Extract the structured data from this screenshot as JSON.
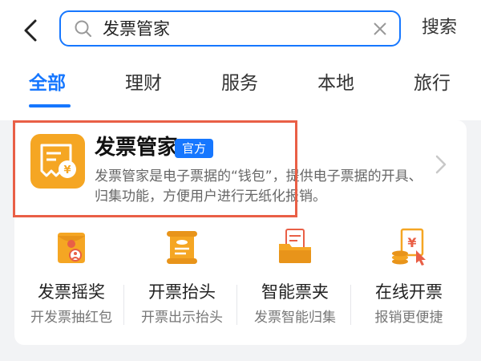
{
  "search": {
    "query": "发票管家",
    "button_label": "搜索"
  },
  "tabs": [
    {
      "label": "全部",
      "active": true
    },
    {
      "label": "理财",
      "active": false
    },
    {
      "label": "服务",
      "active": false
    },
    {
      "label": "本地",
      "active": false
    },
    {
      "label": "旅行",
      "active": false
    }
  ],
  "result": {
    "name": "发票管家",
    "badge": "官方",
    "description": "发票管家是电子票据的“钱包”，提供电子票据的开具、归集功能，方便用户进行无纸化报销。",
    "icon": "invoice-yen-icon"
  },
  "services": [
    {
      "name": "发票摇奖",
      "subtitle": "开发票抽红包",
      "icon": "red-envelope-icon"
    },
    {
      "name": "开票抬头",
      "subtitle": "开票出示抬头",
      "icon": "scroll-icon"
    },
    {
      "name": "智能票夹",
      "subtitle": "发票智能归集",
      "icon": "receipt-folder-icon"
    },
    {
      "name": "在线开票",
      "subtitle": "报销更便捷",
      "icon": "yen-document-icon"
    }
  ],
  "colors": {
    "accent": "#1677ff",
    "highlight": "#e95f46",
    "icon_orange": "#f5a623"
  }
}
